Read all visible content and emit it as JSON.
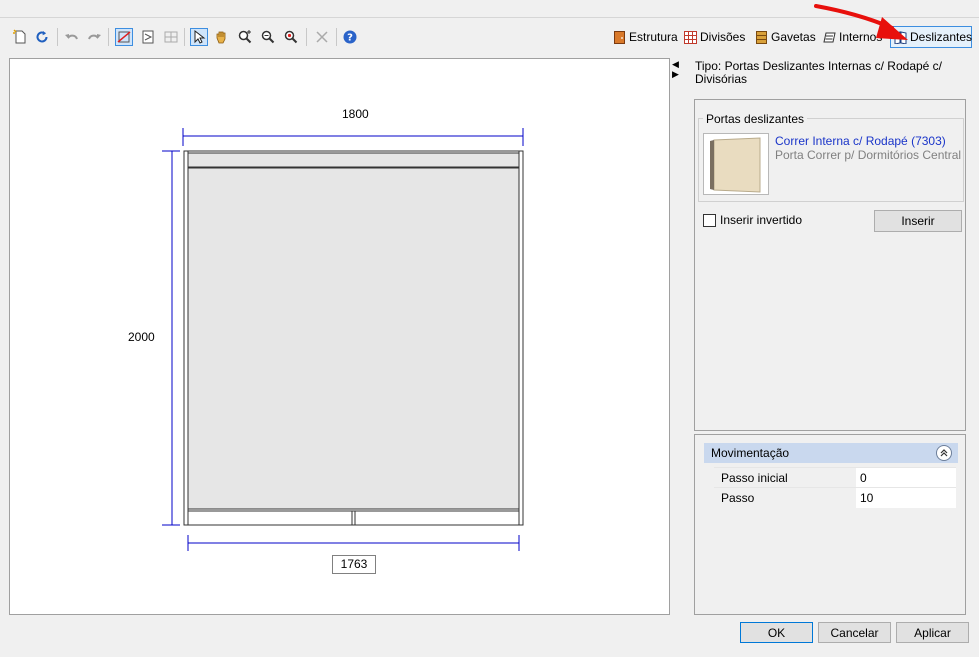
{
  "toolbar": {
    "tools": [
      {
        "icon": "new-icon"
      },
      {
        "icon": "refresh-icon"
      },
      {
        "icon": "undo-icon"
      },
      {
        "icon": "redo-icon"
      },
      {
        "icon": "dimension-tool-icon"
      },
      {
        "icon": "panel-tool-icon"
      },
      {
        "icon": "grid-icon"
      },
      {
        "icon": "select-pointer-icon"
      },
      {
        "icon": "pan-hand-icon"
      },
      {
        "icon": "zoom-window-icon"
      },
      {
        "icon": "zoom-in-icon"
      },
      {
        "icon": "zoom-extents-icon"
      },
      {
        "icon": "delete-icon"
      },
      {
        "icon": "help-icon"
      }
    ],
    "tabs": [
      {
        "label": "Estrutura",
        "icon": "structure-icon"
      },
      {
        "label": "Divisões",
        "icon": "divisions-icon"
      },
      {
        "label": "Gavetas",
        "icon": "drawers-icon"
      },
      {
        "label": "Internos",
        "icon": "internals-icon"
      },
      {
        "label": "Deslizantes",
        "icon": "sliding-doors-icon"
      }
    ],
    "selected_tab": "Deslizantes"
  },
  "canvas": {
    "width_label": "1800",
    "height_label": "2000",
    "bottom_label": "1763"
  },
  "right_panel": {
    "tipo_text": "Tipo: Portas Deslizantes Internas c/ Rodapé c/ Divisórias",
    "group_title": "Portas deslizantes",
    "product_name": "Correr Interna c/ Rodapé (7303)",
    "product_desc": "Porta Correr p/ Dormitórios Central",
    "invert_label": "Inserir invertido",
    "invert_checked": false,
    "insert_button": "Inserir",
    "movement": {
      "title": "Movimentação",
      "properties": [
        {
          "name": "Passo inicial",
          "value": "0"
        },
        {
          "name": "Passo",
          "value": "10"
        }
      ]
    }
  },
  "footer": {
    "ok": "OK",
    "cancel": "Cancelar",
    "apply": "Aplicar"
  },
  "colors": {
    "dimension_line": "#0000c8",
    "selection_blue": "#3d8ee0",
    "link_blue": "#1a35c9",
    "annotation_arrow": "#e8100c"
  }
}
